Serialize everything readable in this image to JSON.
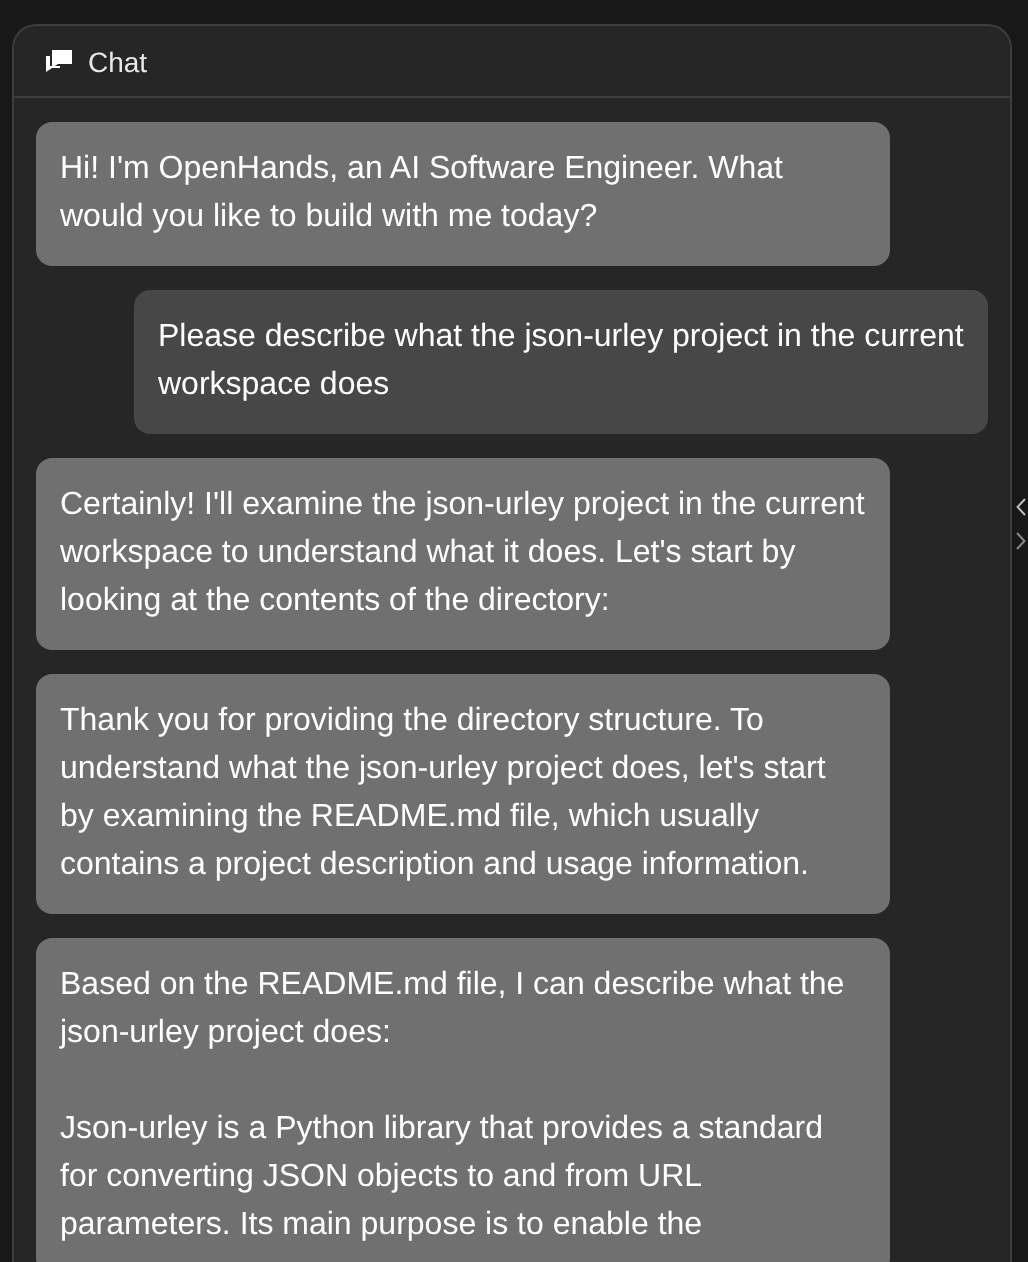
{
  "panel": {
    "title": "Chat"
  },
  "messages": [
    {
      "kind": "agent",
      "paragraphs": [
        "Hi! I'm OpenHands, an AI Software Engineer. What would you like to build with me today?"
      ]
    },
    {
      "kind": "user",
      "paragraphs": [
        "Please describe what the json-urley project in the current workspace does"
      ]
    },
    {
      "kind": "agent",
      "paragraphs": [
        "Certainly! I'll examine the json-urley project in the current workspace to understand what it does. Let's start by looking at the contents of the directory:"
      ]
    },
    {
      "kind": "agent",
      "paragraphs": [
        "Thank you for providing the directory structure. To understand what the json-urley project does, let's start by examining the README.md file, which usually contains a project description and usage information."
      ]
    },
    {
      "kind": "agent",
      "paragraphs": [
        "Based on the README.md file, I can describe what the json-urley project does:",
        "Json-urley is a Python library that provides a standard for converting JSON objects to and from URL parameters. Its main purpose is to enable the"
      ]
    }
  ]
}
